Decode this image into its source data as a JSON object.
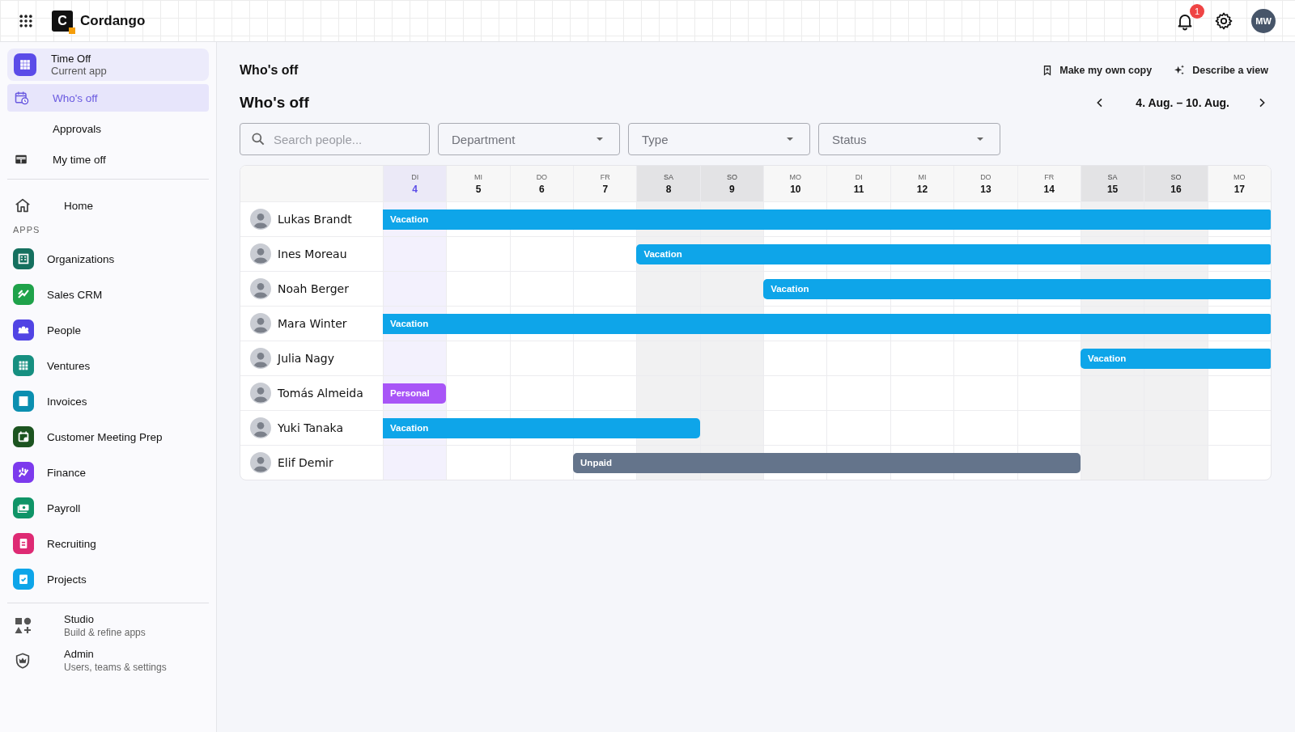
{
  "topbar": {
    "logo_letter": "C",
    "brand": "Cordango",
    "notifications": "1",
    "avatar": "MW"
  },
  "sidebar": {
    "current_app": {
      "title": "Time Off",
      "subtitle": "Current app"
    },
    "nav": [
      {
        "label": "Who's off",
        "selected": true,
        "kind": "calendar"
      },
      {
        "label": "Approvals",
        "selected": false,
        "kind": "none"
      },
      {
        "label": "My time off",
        "selected": false,
        "kind": "table"
      }
    ],
    "home": "Home",
    "apps_heading": "APPS",
    "apps": [
      {
        "label": "Organizations",
        "color": "#15705f"
      },
      {
        "label": "Sales CRM",
        "color": "#1fa24a"
      },
      {
        "label": "People",
        "color": "#5144e4"
      },
      {
        "label": "Ventures",
        "color": "#168f80"
      },
      {
        "label": "Invoices",
        "color": "#0b8fb0"
      },
      {
        "label": "Customer Meeting Prep",
        "color": "#1c5420"
      },
      {
        "label": "Finance",
        "color": "#7c3aed"
      },
      {
        "label": "Payroll",
        "color": "#0f9467"
      },
      {
        "label": "Recruiting",
        "color": "#de2a74"
      },
      {
        "label": "Projects",
        "color": "#0ea5e9"
      }
    ],
    "footer": [
      {
        "title": "Studio",
        "subtitle": "Build & refine apps",
        "kind": "studio"
      },
      {
        "title": "Admin",
        "subtitle": "Users, teams & settings",
        "kind": "admin"
      }
    ]
  },
  "page": {
    "breadcrumb": "Who's off",
    "actions": [
      {
        "label": "Make my own copy",
        "kind": "bookmark"
      },
      {
        "label": "Describe a view",
        "kind": "sparkle"
      }
    ],
    "title": "Who's off",
    "range": "4. Aug. – 10. Aug.",
    "search": {
      "placeholder": "Search people..."
    },
    "dropdowns": [
      {
        "placeholder": "Department"
      },
      {
        "placeholder": "Type"
      },
      {
        "placeholder": "Status"
      }
    ]
  },
  "calendar": {
    "days": [
      {
        "weekday": "DI",
        "date": "4",
        "weekend": false,
        "today": true
      },
      {
        "weekday": "MI",
        "date": "5",
        "weekend": false,
        "today": false
      },
      {
        "weekday": "DO",
        "date": "6",
        "weekend": false,
        "today": false
      },
      {
        "weekday": "FR",
        "date": "7",
        "weekend": false,
        "today": false
      },
      {
        "weekday": "SA",
        "date": "8",
        "weekend": true,
        "today": false
      },
      {
        "weekday": "SO",
        "date": "9",
        "weekend": true,
        "today": false
      },
      {
        "weekday": "MO",
        "date": "10",
        "weekend": false,
        "today": false
      },
      {
        "weekday": "DI",
        "date": "11",
        "weekend": false,
        "today": false
      },
      {
        "weekday": "MI",
        "date": "12",
        "weekend": false,
        "today": false
      },
      {
        "weekday": "DO",
        "date": "13",
        "weekend": false,
        "today": false
      },
      {
        "weekday": "FR",
        "date": "14",
        "weekend": false,
        "today": false
      },
      {
        "weekday": "SA",
        "date": "15",
        "weekend": true,
        "today": false
      },
      {
        "weekday": "SO",
        "date": "16",
        "weekend": true,
        "today": false
      },
      {
        "weekday": "MO",
        "date": "17",
        "weekend": false,
        "today": false
      }
    ],
    "rows": [
      {
        "name": "Lukas Brandt",
        "absence": {
          "label": "Vacation",
          "kind": "vacation",
          "days": [
            true,
            true,
            true,
            true,
            true,
            true,
            true,
            true,
            true,
            true,
            true,
            true,
            true,
            true
          ]
        }
      },
      {
        "name": "Ines Moreau",
        "absence": {
          "label": "Vacation",
          "kind": "vacation",
          "days": [
            false,
            false,
            false,
            false,
            true,
            true,
            true,
            true,
            true,
            true,
            true,
            true,
            true,
            true
          ]
        }
      },
      {
        "name": "Noah Berger",
        "absence": {
          "label": "Vacation",
          "kind": "vacation",
          "days": [
            false,
            false,
            false,
            false,
            false,
            false,
            true,
            true,
            true,
            true,
            true,
            true,
            true,
            true
          ]
        }
      },
      {
        "name": "Mara Winter",
        "absence": {
          "label": "Vacation",
          "kind": "vacation",
          "days": [
            true,
            true,
            true,
            true,
            true,
            true,
            true,
            true,
            true,
            true,
            true,
            true,
            true,
            true
          ]
        }
      },
      {
        "name": "Julia Nagy",
        "absence": {
          "label": "Vacation",
          "kind": "vacation",
          "days": [
            false,
            false,
            false,
            false,
            false,
            false,
            false,
            false,
            false,
            false,
            false,
            true,
            true,
            true
          ]
        }
      },
      {
        "name": "Tomás Almeida",
        "absence": {
          "label": "Personal",
          "kind": "personal",
          "days": [
            true,
            false,
            false,
            false,
            false,
            false,
            false,
            false,
            false,
            false,
            false,
            false,
            false,
            false
          ]
        }
      },
      {
        "name": "Yuki Tanaka",
        "absence": {
          "label": "Vacation",
          "kind": "vacation",
          "days": [
            true,
            true,
            true,
            true,
            true,
            false,
            false,
            false,
            false,
            false,
            false,
            false,
            false,
            false
          ]
        }
      },
      {
        "name": "Elif Demir",
        "absence": {
          "label": "Unpaid",
          "kind": "unpaid",
          "days": [
            false,
            false,
            false,
            true,
            true,
            true,
            true,
            true,
            true,
            true,
            true,
            false,
            false,
            false
          ]
        }
      }
    ]
  }
}
